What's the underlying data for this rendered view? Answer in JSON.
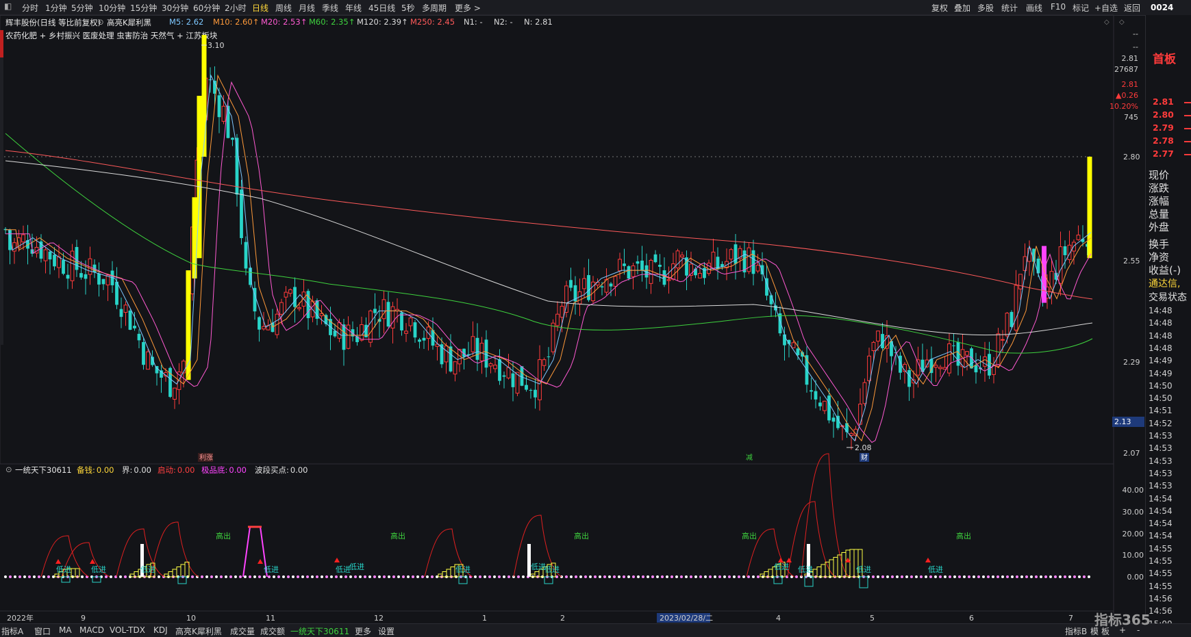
{
  "toolbar": {
    "periods": [
      "分时",
      "1分钟",
      "5分钟",
      "10分钟",
      "15分钟",
      "30分钟",
      "60分钟",
      "2小时",
      "日线",
      "周线",
      "月线",
      "季线",
      "年线",
      "45日线",
      "5秒",
      "多周期",
      "更多 >"
    ],
    "active_period": "日线",
    "right_buttons": [
      "复权",
      "叠加",
      "多股",
      "统计",
      "画线",
      "F10",
      "标记",
      "+自选",
      "返回"
    ],
    "clock": "0024"
  },
  "main": {
    "stock_title": "辉丰股份(日线 等比前复权)",
    "indicator_name": "高亮K犀利黑",
    "ma": [
      {
        "label": "M5: 2.62",
        "color": "#7ec8ff"
      },
      {
        "label": "M10: 2.60↑",
        "color": "#ff9a3a"
      },
      {
        "label": "M20: 2.53↑",
        "color": "#ff5ad2"
      },
      {
        "label": "M60: 2.35↑",
        "color": "#3ed23e"
      },
      {
        "label": "M120: 2.39↑",
        "color": "#dcdcdc"
      },
      {
        "label": "M250: 2.45",
        "color": "#ff5a5a"
      },
      {
        "label": "N1: -",
        "color": "#dcdcdc"
      },
      {
        "label": "N2: -",
        "color": "#dcdcdc"
      },
      {
        "label": "N: 2.81",
        "color": "#dcdcdc"
      }
    ],
    "concepts": "农药化肥 + 乡村振兴 医废处理 虫害防治 天然气 + 江苏板块",
    "y_ticks": [
      "2.80",
      "2.55",
      "2.29",
      "2.07"
    ],
    "high_label": "3.10",
    "low_label": "2.08",
    "price_top": [
      "--",
      "--",
      "2.81",
      "27687",
      "2.81",
      "▲0.26",
      "10.20%",
      "745"
    ],
    "current_price_tag": "2.13",
    "markers": [
      "利涨",
      "减",
      "财"
    ]
  },
  "indicator": {
    "name": "一统天下30611",
    "fields": [
      {
        "label": "备钱:",
        "value": "0.00",
        "color": "#ffd83a"
      },
      {
        "label": "界:",
        "value": "0.00",
        "color": "#e0e0e0"
      },
      {
        "label": "启动:",
        "value": "0.00",
        "color": "#ff4040"
      },
      {
        "label": "极品底:",
        "value": "0.00",
        "color": "#ff44ff"
      },
      {
        "label": "波段买点:",
        "value": "0.00",
        "color": "#e0e0e0"
      }
    ],
    "y_ticks": [
      "40.00",
      "30.00",
      "20.00",
      "10.00",
      "0.00"
    ],
    "gao_chu": "高出",
    "di_jin": "低进"
  },
  "x_axis": {
    "labels": [
      "2022年",
      "9",
      "10",
      "11",
      "12",
      "1",
      "2",
      "2023/02/28/二",
      "4",
      "5",
      "6",
      "7"
    ]
  },
  "right_panel": {
    "title": "首板",
    "levels": [
      "2.81",
      "2.80",
      "2.79",
      "2.78",
      "2.77"
    ],
    "info_labels": [
      "现价",
      "涨跌",
      "涨幅",
      "总量",
      "外盘",
      "换手",
      "净资",
      "收益(-)"
    ],
    "tongdaxin": "通达信,",
    "trade_state": "交易状态",
    "times": [
      "14:48",
      "14:48",
      "14:48",
      "14:48",
      "14:49",
      "14:49",
      "14:50",
      "14:50",
      "14:51",
      "14:52",
      "14:53",
      "14:53",
      "14:53",
      "14:53",
      "14:53",
      "14:54",
      "14:54",
      "14:54",
      "14:54",
      "14:55",
      "14:55",
      "14:55",
      "14:55",
      "14:56",
      "14:56",
      "15:00"
    ]
  },
  "bottom_tabs": [
    "指标A",
    "窗口",
    "MA",
    "MACD",
    "VOL-TDX",
    "KDJ",
    "高亮K犀利黑",
    "成交量",
    "成交额",
    "一统天下30611",
    "更多",
    "设置"
  ],
  "bottom_right": [
    "指标B",
    "模",
    "板",
    "+",
    "-"
  ],
  "watermark": "指标365",
  "colors": {
    "up": "#ff3b3b",
    "down": "#28d4c8",
    "yellow": "#ffff00",
    "magenta": "#ff44ff"
  }
}
